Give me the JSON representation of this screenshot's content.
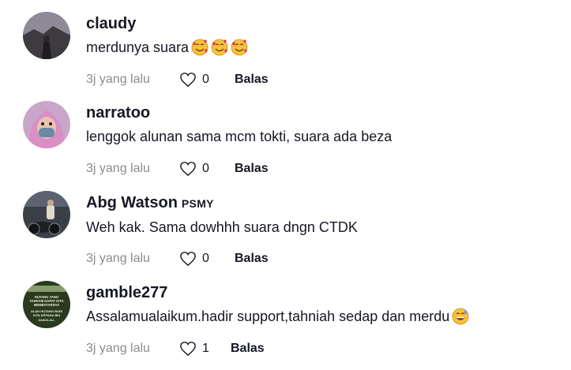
{
  "comments": [
    {
      "username": "claudy",
      "badge": "",
      "text": "merdunya suara",
      "emojis": [
        "smiling-face-with-hearts",
        "smiling-face-with-hearts",
        "smiling-face-with-hearts"
      ],
      "time": "3j yang lalu",
      "likes": "0",
      "reply_label": "Balas"
    },
    {
      "username": "narratoo",
      "badge": "",
      "text": "lenggok alunan sama mcm tokti, suara ada beza",
      "emojis": [],
      "time": "3j yang lalu",
      "likes": "0",
      "reply_label": "Balas"
    },
    {
      "username": "Abg Watson",
      "badge": "PSMY",
      "text": "Weh kak. Sama dowhhh suara dngn CTDK",
      "emojis": [],
      "time": "3j yang lalu",
      "likes": "0",
      "reply_label": "Balas"
    },
    {
      "username": "gamble277",
      "badge": "",
      "text": "Assalamualaikum.hadir support,tahniah sedap dan merdu",
      "emojis": [
        "grinning-face-with-sweat"
      ],
      "time": "3j yang lalu",
      "likes": "1",
      "reply_label": "Balas"
    }
  ],
  "avatar_text": {
    "gamble277": [
      "HUTANG YANG",
      "TAHKAM DAPAT KITA",
      "MEMBAYARNYA",
      "ALAH HUTANG BUDI",
      "KITA KEPADA IBU",
      "DANGA ALL"
    ]
  },
  "colors": {
    "meta_gray": "#8a8b91",
    "text_dark": "#161823",
    "emoji_yellow": "#f7c23c"
  }
}
